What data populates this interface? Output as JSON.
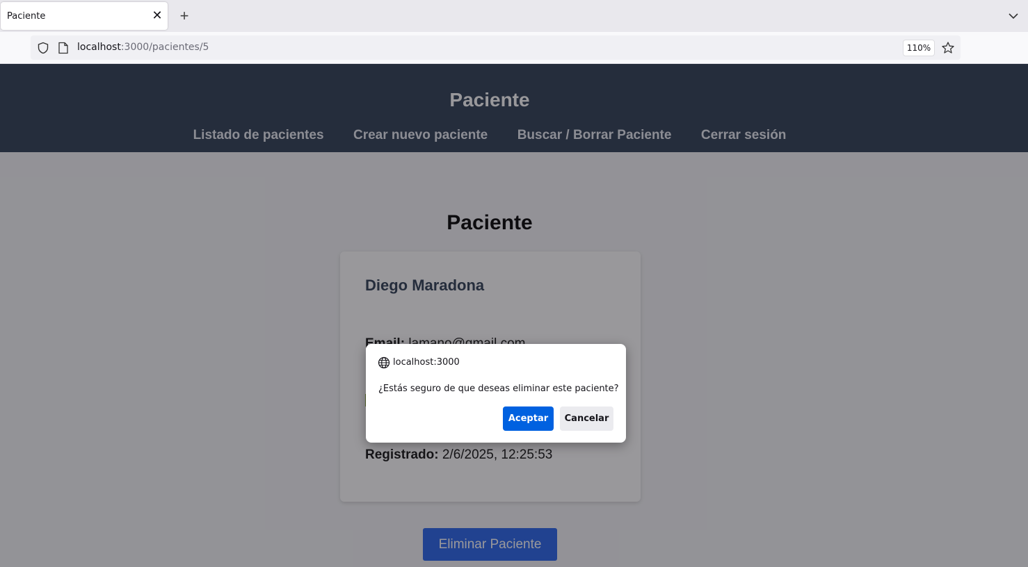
{
  "browser": {
    "tab_title": "Paciente",
    "tab_close": "✕",
    "new_tab": "+",
    "url_host": "localhost",
    "url_path": ":3000/pacientes/5",
    "zoom": "110%"
  },
  "site": {
    "title": "Paciente",
    "nav": [
      "Listado de pacientes",
      "Crear nuevo paciente",
      "Buscar / Borrar Paciente",
      "Cerrar sesión"
    ]
  },
  "main": {
    "title": "Paciente",
    "patient": {
      "name": "Diego Maradona",
      "email_label": "Email:",
      "email_value": "lamano@gmail.com",
      "registered_label": "Registrado:",
      "registered_value": "2/6/2025, 12:25:53"
    },
    "delete_button": "Eliminar Paciente"
  },
  "dialog": {
    "origin": "localhost:3000",
    "message": "¿Estás seguro de que deseas eliminar este paciente?",
    "accept": "Aceptar",
    "cancel": "Cancelar"
  },
  "colors": {
    "header_bg": "#2d3c52",
    "primary_button": "#2563eb",
    "dialog_accept": "#0061e0"
  }
}
